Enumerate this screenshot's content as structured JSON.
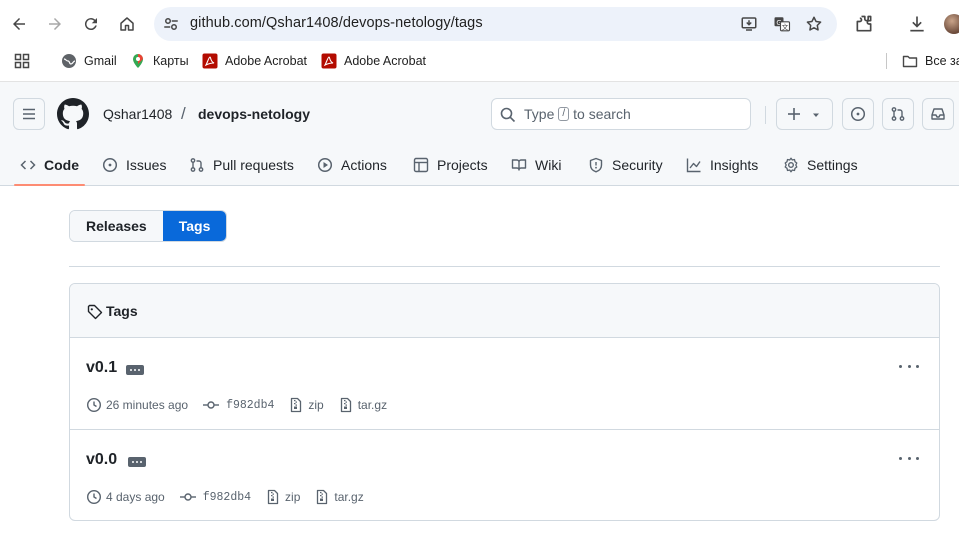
{
  "browser": {
    "url": "github.com/Qshar1408/devops-netology/tags",
    "bookmarks": [
      {
        "label": "Gmail",
        "icon": "globe-icon"
      },
      {
        "label": "Карты",
        "icon": "maps-pin-icon"
      },
      {
        "label": "Adobe Acrobat",
        "icon": "acrobat-icon"
      },
      {
        "label": "Adobe Acrobat",
        "icon": "acrobat-icon"
      }
    ],
    "all_bookmarks_label": "Все за"
  },
  "header": {
    "owner": "Qshar1408",
    "separator": "/",
    "repo": "devops-netology",
    "search_prefix": "Type",
    "search_key": "/",
    "search_suffix": "to search"
  },
  "tabs": [
    {
      "label": "Code",
      "icon": "code-icon",
      "active": true
    },
    {
      "label": "Issues",
      "icon": "issue-icon"
    },
    {
      "label": "Pull requests",
      "icon": "pull-request-icon"
    },
    {
      "label": "Actions",
      "icon": "play-icon"
    },
    {
      "label": "Projects",
      "icon": "table-icon"
    },
    {
      "label": "Wiki",
      "icon": "book-icon"
    },
    {
      "label": "Security",
      "icon": "shield-icon"
    },
    {
      "label": "Insights",
      "icon": "graph-icon"
    },
    {
      "label": "Settings",
      "icon": "gear-icon"
    }
  ],
  "segmented": {
    "releases": "Releases",
    "tags": "Tags",
    "selected": "Tags"
  },
  "tags_box": {
    "title": "Tags",
    "items": [
      {
        "name": "v0.1",
        "time": "26 minutes ago",
        "commit": "f982db4",
        "zip": "zip",
        "targz": "tar.gz"
      },
      {
        "name": "v0.0",
        "time": "4 days ago",
        "commit": "f982db4",
        "zip": "zip",
        "targz": "tar.gz"
      }
    ]
  },
  "colors": {
    "accent_blue": "#0969da",
    "tab_underline": "#fd8c73",
    "border": "#d1d9e0",
    "muted_text": "#59636e"
  }
}
